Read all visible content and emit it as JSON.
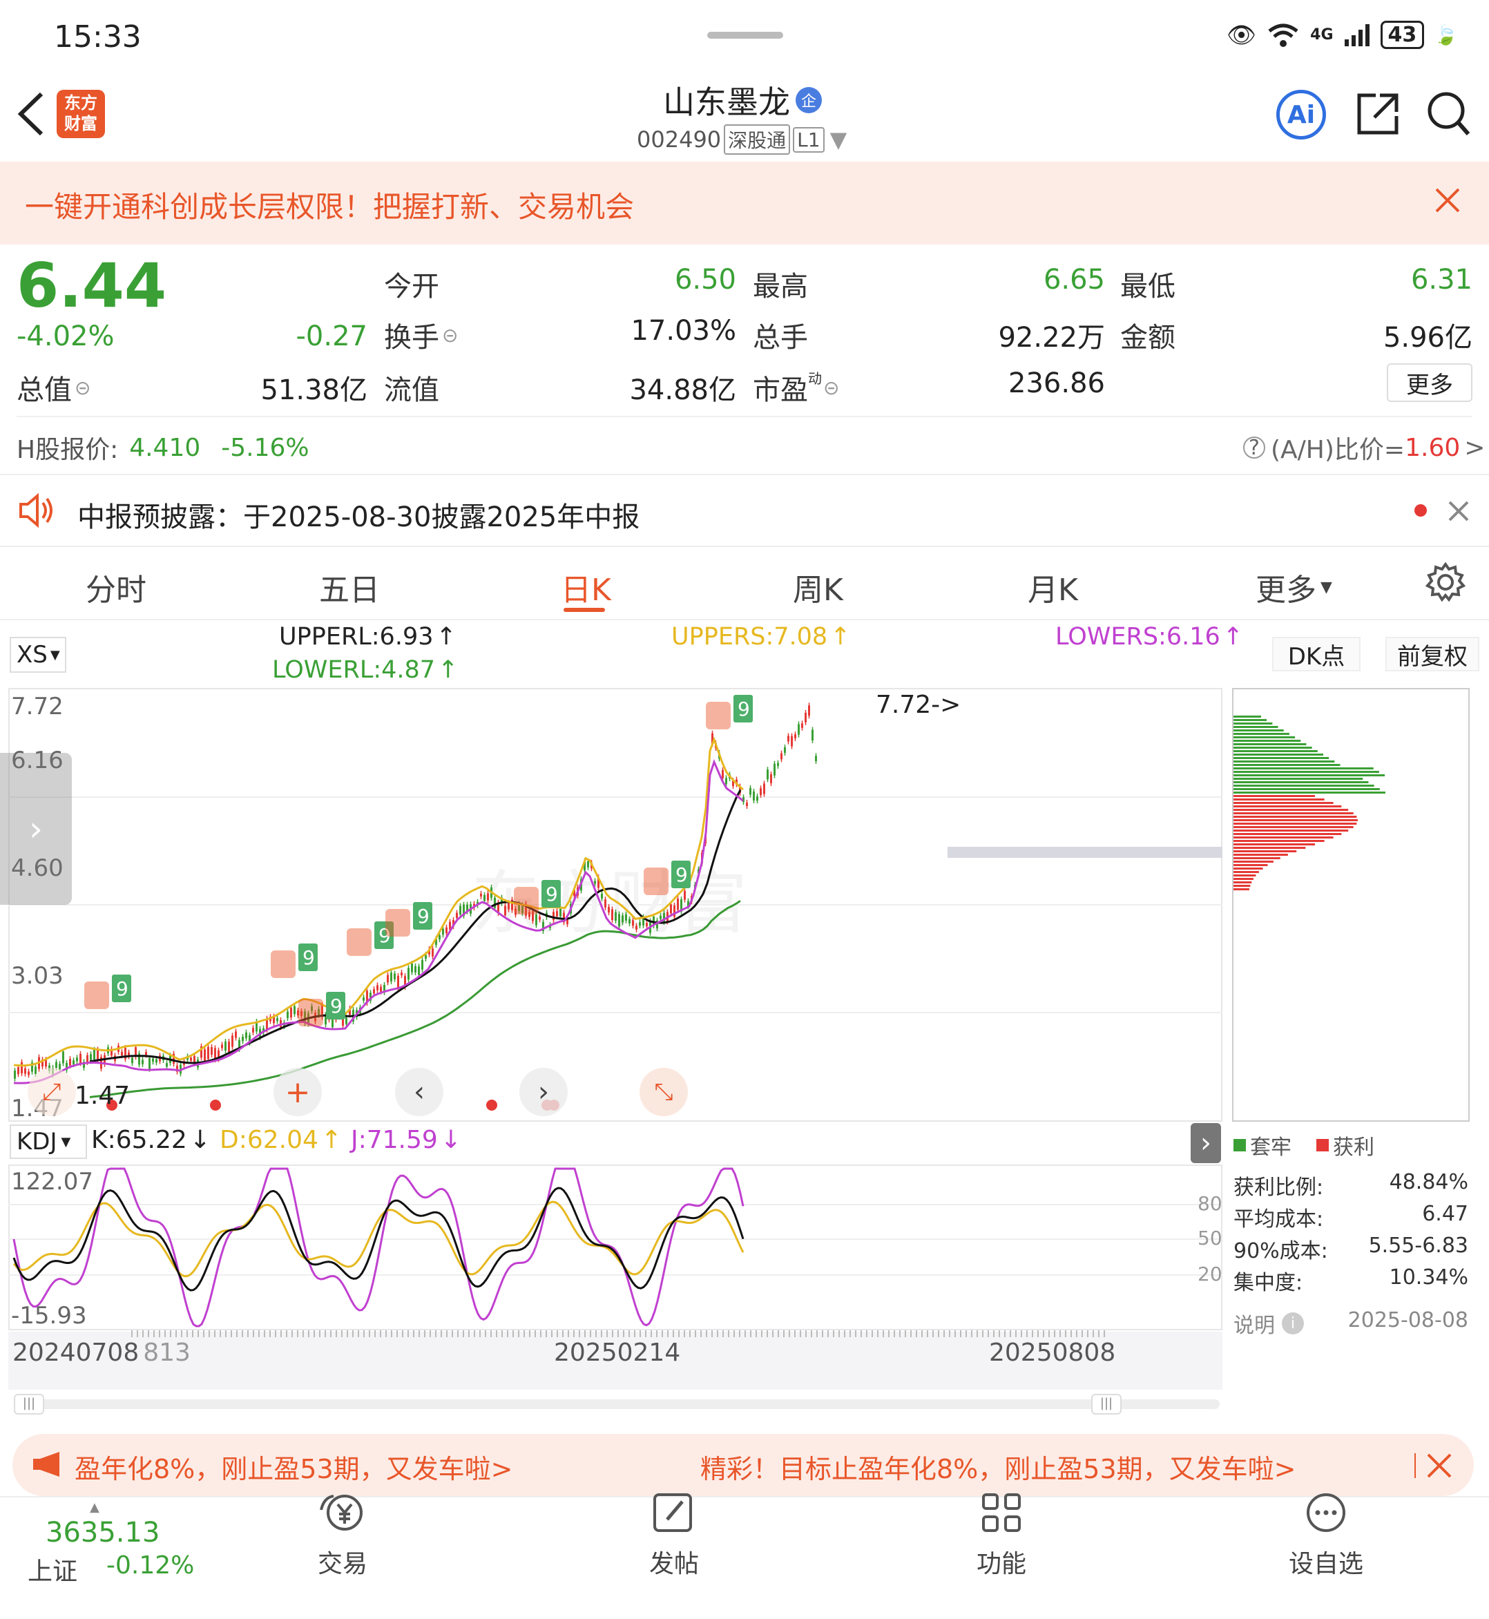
{
  "status_bar": {
    "time": "15:33",
    "signal": "4G",
    "battery": "43"
  },
  "header": {
    "logo_line1": "东方",
    "logo_line2": "财富",
    "stock_name": "山东墨龙",
    "badge": "企",
    "stock_code": "002490",
    "tag_connect": "深股通",
    "tag_level": "L1"
  },
  "promo_banner": {
    "text": "一键开通科创成长层权限！把握打新、交易机会"
  },
  "quote": {
    "price": "6.44",
    "change_pct": "-4.02%",
    "change": "-0.27",
    "open_label": "今开",
    "open": "6.50",
    "high_label": "最高",
    "high": "6.65",
    "low_label": "最低",
    "low": "6.31",
    "turnover_label": "换手",
    "turnover": "17.03%",
    "volume_label": "总手",
    "volume": "92.22万",
    "amount_label": "金额",
    "amount": "5.96亿",
    "mktcap_label": "总值",
    "mktcap": "51.38亿",
    "float_label": "流值",
    "float_cap": "34.88亿",
    "pe_label": "市盈",
    "pe_super": "动",
    "pe": "236.86",
    "more": "更多"
  },
  "hshare": {
    "label": "H股报价:",
    "price": "4.410",
    "change": "-5.16%",
    "ratio_label": "(A/H)比价=",
    "ratio": "1.60"
  },
  "notice": {
    "text": "中报预披露：于2025-08-30披露2025年中报"
  },
  "tabs": [
    "分时",
    "五日",
    "日K",
    "周K",
    "月K",
    "更多"
  ],
  "active_tab": "日K",
  "indicators": {
    "xs": "XS",
    "upperl": "UPPERL:6.93",
    "lowerl": "LOWERL:4.87",
    "uppers": "UPPERS:7.08",
    "lowers": "LOWERS:6.16",
    "dk": "DK点",
    "adjust": "前复权"
  },
  "main_chart": {
    "y_labels": [
      "7.72",
      "6.16",
      "4.60",
      "3.03",
      "1.47"
    ],
    "max_label": "7.72->",
    "min_label": "1.47",
    "colors": {
      "up": "#e53935",
      "down": "#3aa035",
      "ma_black": "#111",
      "uppers": "#e6b820",
      "lowers": "#c040d0",
      "green_line": "#3a9a35"
    }
  },
  "chip": {
    "legend_trap": "套牢",
    "legend_profit": "获利",
    "profit_ratio_label": "获利比例:",
    "profit_ratio": "48.84%",
    "avg_cost_label": "平均成本:",
    "avg_cost": "6.47",
    "cost90_label": "90%成本:",
    "cost90": "5.55-6.83",
    "concentration_label": "集中度:",
    "concentration": "10.34%",
    "note_label": "说明",
    "date": "2025-08-08"
  },
  "kdj": {
    "name": "KDJ",
    "k": "K:65.22",
    "d": "D:62.04",
    "j": "J:71.59",
    "y_top": "122.07",
    "y_bottom": "-15.93",
    "levels": [
      "80",
      "50",
      "20"
    ]
  },
  "x_axis": {
    "d1": "20240708",
    "d1b": "813",
    "d2": "20250214",
    "d3": "20250808"
  },
  "ad_bar": {
    "left": "盈年化8%，刚止盈53期，又发车啦>",
    "right": "精彩！目标止盈年化8%，刚止盈53期，又发车啦>"
  },
  "bottom_nav": {
    "index_value": "3635.13",
    "index_name": "上证",
    "index_change": "-0.12%",
    "trade": "交易",
    "post": "发帖",
    "func": "功能",
    "watch": "设自选"
  }
}
